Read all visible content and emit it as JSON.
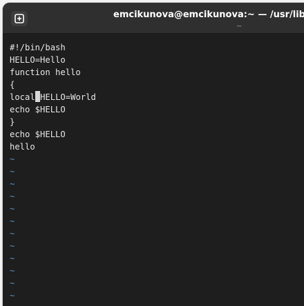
{
  "window": {
    "title": "emcikunova@emcikunova:~ — /usr/libexe",
    "subtitle": "~"
  },
  "icons": {
    "new_tab": "plus-in-square-icon"
  },
  "colors": {
    "terminal_background": "#1e1e1e",
    "text": "#e6e6e6",
    "tilde": "#5b8fc4",
    "titlebar": "#2f2f2f"
  },
  "editor": {
    "lines": [
      "#!/bin/bash",
      "HELLO=Hello",
      "function hello",
      "{",
      "local",
      "echo $HELLO",
      "}",
      "echo $HELLO",
      "hello"
    ],
    "cursor_line_after": "HELLO=World",
    "empty_line_marker": "~"
  }
}
